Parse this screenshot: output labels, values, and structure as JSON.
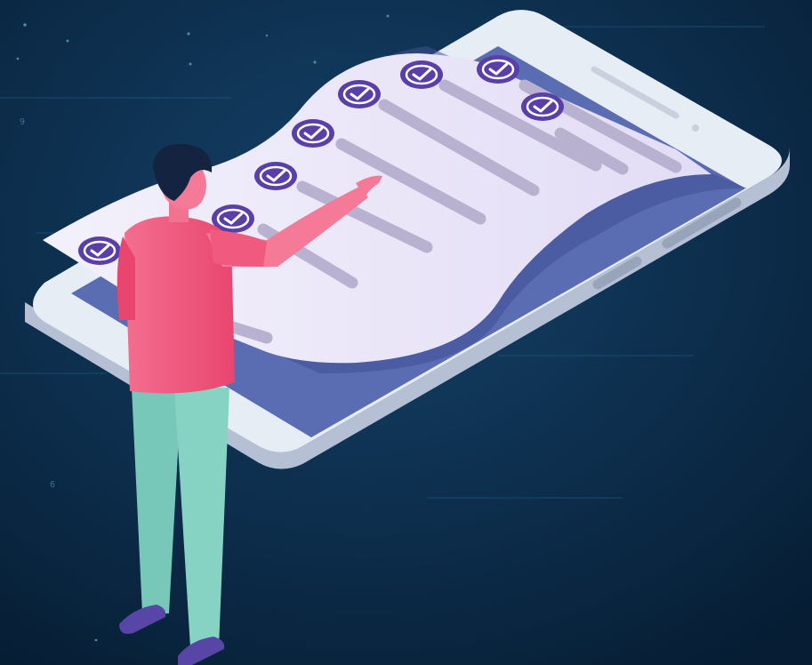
{
  "illustration": {
    "subject": "person-checking-phone-checklist",
    "checked_item_count": 8,
    "icon": "checkmark-circle-icon"
  },
  "background_digits": [
    "9",
    "6"
  ],
  "colors": {
    "background_dark": "#061d33",
    "background_light": "#123c5e",
    "phone_body": "#e9eef6",
    "phone_side": "#b8c3d6",
    "screen": "#5b6fb5",
    "sheet": "#ece8f8",
    "check_badge": "#5a3fa8",
    "shirt": "#f05a7e",
    "pants": "#7fcfc0",
    "hair": "#13233f"
  }
}
